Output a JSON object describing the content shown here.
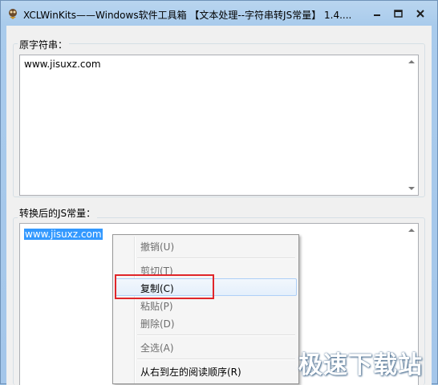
{
  "window": {
    "title": "XCLWinKits——Windows软件工具箱 【文本处理--字符串转JS常量】 1.4...."
  },
  "source_group": {
    "label": "原字符串：",
    "text": "www.jisuxz.com"
  },
  "result_group": {
    "label": "转换后的JS常量：",
    "text": "www.jisuxz.com"
  },
  "context_menu": {
    "items": [
      {
        "label": "撤销(U)",
        "state": "disabled"
      },
      {
        "label": "剪切(T)",
        "state": "disabled"
      },
      {
        "label": "复制(C)",
        "state": "hover"
      },
      {
        "label": "粘贴(P)",
        "state": "disabled"
      },
      {
        "label": "删除(D)",
        "state": "disabled"
      },
      {
        "label": "全选(A)",
        "state": "disabled"
      },
      {
        "label": "从右到左的阅读顺序(R)",
        "state": "enabled"
      }
    ]
  },
  "watermark": "极速下载站",
  "colors": {
    "highlight_border": "#e0262a",
    "selection": "#3399ff",
    "menu_hover": "#aecff7"
  },
  "icons": [
    "app-icon",
    "minimize-icon",
    "maximize-icon",
    "close-icon",
    "scroll-up-icon",
    "scroll-down-icon"
  ]
}
